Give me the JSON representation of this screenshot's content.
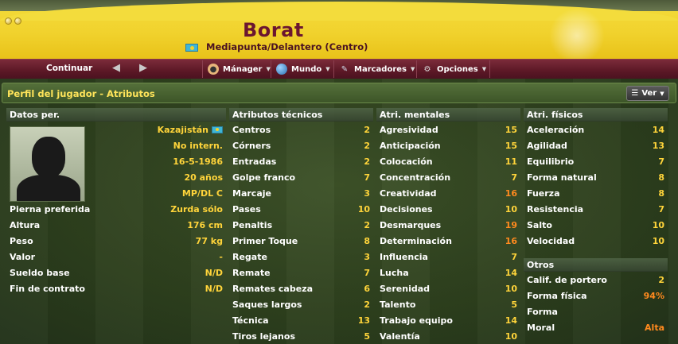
{
  "header": {
    "player_name": "Borat",
    "position": "Mediapunta/Delantero (Centro)",
    "flag_icon": "kazakhstan-flag-icon"
  },
  "toolbar": {
    "continue_label": "Continuar",
    "back_icon": "arrow-left-icon",
    "forward_icon": "arrow-right-icon",
    "menus": [
      {
        "label": "Mánager",
        "icon": "manager-icon"
      },
      {
        "label": "Mundo",
        "icon": "globe-icon"
      },
      {
        "label": "Marcadores",
        "icon": "bookmark-icon"
      },
      {
        "label": "Opciones",
        "icon": "gears-icon"
      }
    ]
  },
  "panel": {
    "title": "Perfil del jugador - Atributos",
    "ver_label": "Ver"
  },
  "personal": {
    "heading": "Datos per.",
    "nationality": "Kazajistán",
    "international": "No intern.",
    "birthdate": "16-5-1986",
    "age": "20 años",
    "positions": "MP/DL C",
    "rows": [
      {
        "label": "Pierna preferida",
        "value": "Zurda sólo"
      },
      {
        "label": "Altura",
        "value": "176 cm"
      },
      {
        "label": "Peso",
        "value": "77 kg"
      },
      {
        "label": "Valor",
        "value": "-"
      },
      {
        "label": "Sueldo base",
        "value": "N/D"
      },
      {
        "label": "Fin de contrato",
        "value": "N/D"
      }
    ]
  },
  "technical": {
    "heading": "Atributos técnicos",
    "rows": [
      {
        "label": "Centros",
        "value": "2"
      },
      {
        "label": "Córners",
        "value": "2"
      },
      {
        "label": "Entradas",
        "value": "2"
      },
      {
        "label": "Golpe franco",
        "value": "7"
      },
      {
        "label": "Marcaje",
        "value": "3"
      },
      {
        "label": "Pases",
        "value": "10"
      },
      {
        "label": "Penaltis",
        "value": "2"
      },
      {
        "label": "Primer Toque",
        "value": "8"
      },
      {
        "label": "Regate",
        "value": "3"
      },
      {
        "label": "Remate",
        "value": "7"
      },
      {
        "label": "Remates cabeza",
        "value": "6"
      },
      {
        "label": "Saques largos",
        "value": "2"
      },
      {
        "label": "Técnica",
        "value": "13"
      },
      {
        "label": "Tiros lejanos",
        "value": "5"
      }
    ]
  },
  "mental": {
    "heading": "Atri. mentales",
    "rows": [
      {
        "label": "Agresividad",
        "value": "15"
      },
      {
        "label": "Anticipación",
        "value": "15"
      },
      {
        "label": "Colocación",
        "value": "11"
      },
      {
        "label": "Concentración",
        "value": "7"
      },
      {
        "label": "Creatividad",
        "value": "16"
      },
      {
        "label": "Decisiones",
        "value": "10"
      },
      {
        "label": "Desmarques",
        "value": "19"
      },
      {
        "label": "Determinación",
        "value": "16"
      },
      {
        "label": "Influencia",
        "value": "7"
      },
      {
        "label": "Lucha",
        "value": "14"
      },
      {
        "label": "Serenidad",
        "value": "10"
      },
      {
        "label": "Talento",
        "value": "5"
      },
      {
        "label": "Trabajo equipo",
        "value": "14"
      },
      {
        "label": "Valentía",
        "value": "10"
      }
    ]
  },
  "physical": {
    "heading": "Atri. físicos",
    "rows": [
      {
        "label": "Aceleración",
        "value": "14"
      },
      {
        "label": "Agilidad",
        "value": "13"
      },
      {
        "label": "Equilibrio",
        "value": "7"
      },
      {
        "label": "Forma natural",
        "value": "8"
      },
      {
        "label": "Fuerza",
        "value": "8"
      },
      {
        "label": "Resistencia",
        "value": "7"
      },
      {
        "label": "Salto",
        "value": "10"
      },
      {
        "label": "Velocidad",
        "value": "10"
      }
    ]
  },
  "others": {
    "heading": "Otros",
    "rows": [
      {
        "label": "Calif. de portero",
        "value": "2"
      },
      {
        "label": "Forma física",
        "value": "94%"
      },
      {
        "label": "Forma",
        "value": ""
      },
      {
        "label": "Moral",
        "value": "Alta"
      }
    ]
  },
  "colors": {
    "value_yellow": "#ffd43a",
    "value_orange": "#ff8a1e",
    "title_yellow": "#ffe45a",
    "banner_yellow": "#f3dc3c",
    "toolbar_maroon": "#5c1826",
    "name_maroon": "#6b1630"
  }
}
